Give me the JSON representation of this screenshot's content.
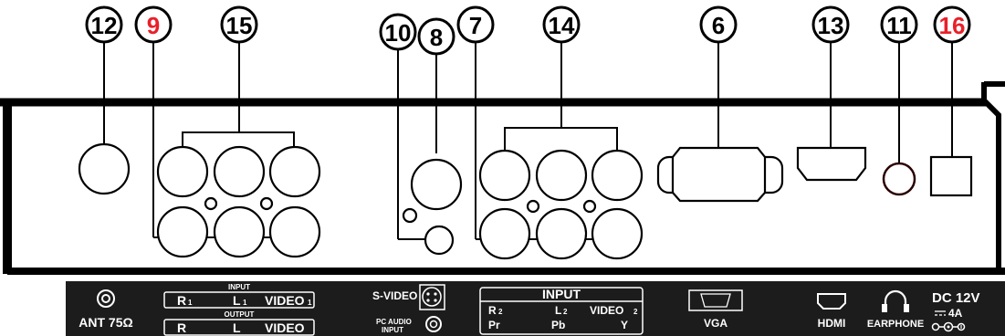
{
  "callouts": [
    {
      "id": "12",
      "label": "12",
      "color": "#000000"
    },
    {
      "id": "9",
      "label": "9",
      "color": "#e8202a"
    },
    {
      "id": "15",
      "label": "15",
      "color": "#000000"
    },
    {
      "id": "10",
      "label": "10",
      "color": "#000000"
    },
    {
      "id": "8",
      "label": "8",
      "color": "#000000"
    },
    {
      "id": "7",
      "label": "7",
      "color": "#000000"
    },
    {
      "id": "14",
      "label": "14",
      "color": "#000000"
    },
    {
      "id": "6",
      "label": "6",
      "color": "#000000"
    },
    {
      "id": "13",
      "label": "13",
      "color": "#000000"
    },
    {
      "id": "11",
      "label": "11",
      "color": "#000000"
    },
    {
      "id": "16",
      "label": "16",
      "color": "#e8202a"
    }
  ],
  "label_strip": {
    "ant": "ANT 75Ω",
    "input1": {
      "title": "INPUT",
      "r": "R",
      "r_sub": "1",
      "l": "L",
      "l_sub": "1",
      "video": "VIDEO",
      "video_sub": "1"
    },
    "output": {
      "title": "OUTPUT",
      "r": "R",
      "l": "L",
      "video": "VIDEO"
    },
    "svideo": "S-VIDEO",
    "pc_audio_line1": "PC AUDIO",
    "pc_audio_line2": "INPUT",
    "input2": {
      "title": "INPUT",
      "r": "R",
      "r_sub": "2",
      "l": "L",
      "l_sub": "2",
      "video": "VIDEO",
      "video_sub": "2",
      "pr": "Pr",
      "pb": "Pb",
      "y": "Y"
    },
    "vga": "VGA",
    "hdmi": "HDMI",
    "earphone": "EARPHONE",
    "dc": "DC 12V",
    "dc_rating": "4A"
  },
  "colors": {
    "panel": "#000000",
    "strip": "#1a1a1a",
    "accent_red": "#e8202a"
  }
}
